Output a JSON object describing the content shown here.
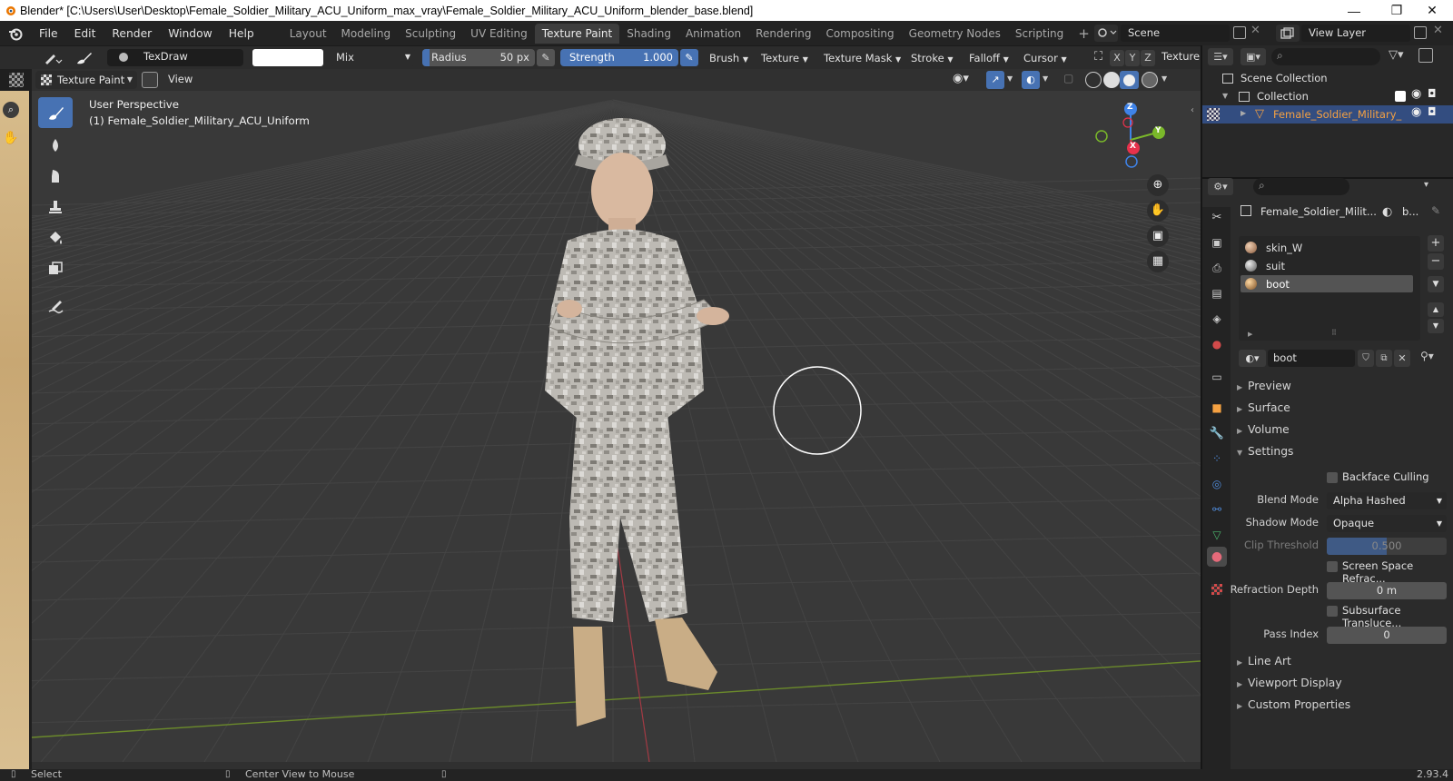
{
  "window": {
    "title": "Blender* [C:\\Users\\User\\Desktop\\Female_Soldier_Military_ACU_Uniform_max_vray\\Female_Soldier_Military_ACU_Uniform_blender_base.blend]",
    "minimize": "—",
    "maximize": "❐",
    "close": "✕"
  },
  "menu": [
    "File",
    "Edit",
    "Render",
    "Window",
    "Help"
  ],
  "workspaces": [
    {
      "label": "Layout",
      "active": false
    },
    {
      "label": "Modeling",
      "active": false
    },
    {
      "label": "Sculpting",
      "active": false
    },
    {
      "label": "UV Editing",
      "active": false
    },
    {
      "label": "Texture Paint",
      "active": true
    },
    {
      "label": "Shading",
      "active": false
    },
    {
      "label": "Animation",
      "active": false
    },
    {
      "label": "Rendering",
      "active": false
    },
    {
      "label": "Compositing",
      "active": false
    },
    {
      "label": "Geometry Nodes",
      "active": false
    },
    {
      "label": "Scripting",
      "active": false
    }
  ],
  "add_workspace": "+",
  "scene": {
    "label": "Scene",
    "view_layer": "View Layer"
  },
  "tool_header": {
    "brush_name": "TexDraw",
    "color_swatch": "#ffffff",
    "blend": "Mix",
    "radius_label": "Radius",
    "radius_value": "50 px",
    "strength_label": "Strength",
    "strength_value": "1.000",
    "brush": "Brush",
    "texture": "Texture",
    "texture_mask": "Texture Mask",
    "stroke": "Stroke",
    "falloff": "Falloff",
    "cursor": "Cursor",
    "axis_x": "X",
    "axis_y": "Y",
    "axis_z": "Z",
    "texture_slots": "Texture"
  },
  "header2": {
    "mode": "Texture Paint",
    "view": "View"
  },
  "viewport": {
    "perspective": "User Perspective",
    "object_label": "(1) Female_Soldier_Military_ACU_Uniform",
    "gizmo_x": "X",
    "gizmo_y": "Y",
    "gizmo_z": "Z"
  },
  "outliner": {
    "root": "Scene Collection",
    "collection": "Collection",
    "object": "Female_Soldier_Military_"
  },
  "properties": {
    "object_name": "Female_Soldier_Milit...",
    "material_short": "b...",
    "materials": [
      "skin_W",
      "suit",
      "boot"
    ],
    "selected_material_index": 2,
    "material_name": "boot",
    "sections": {
      "preview": "Preview",
      "surface": "Surface",
      "volume": "Volume",
      "settings": "Settings",
      "line_art": "Line Art",
      "viewport_display": "Viewport Display",
      "custom_properties": "Custom Properties"
    },
    "backface_culling": "Backface Culling",
    "blend_mode_label": "Blend Mode",
    "blend_mode": "Alpha Hashed",
    "shadow_mode_label": "Shadow Mode",
    "shadow_mode": "Opaque",
    "clip_threshold_label": "Clip Threshold",
    "clip_threshold": "0.500",
    "screen_space_refraction": "Screen Space Refrac...",
    "refraction_depth_label": "Refraction Depth",
    "refraction_depth": "0 m",
    "subsurface_translucency": "Subsurface Transluce...",
    "pass_index_label": "Pass Index",
    "pass_index": "0"
  },
  "status": {
    "select": "Select",
    "center_view": "Center View to Mouse",
    "version": "2.93.4"
  },
  "colors": {
    "accent": "#4772b3",
    "active_orange": "#f5a142",
    "x_axis": "#e8314c",
    "y_axis": "#7ab82a",
    "z_axis": "#3f83e8"
  }
}
